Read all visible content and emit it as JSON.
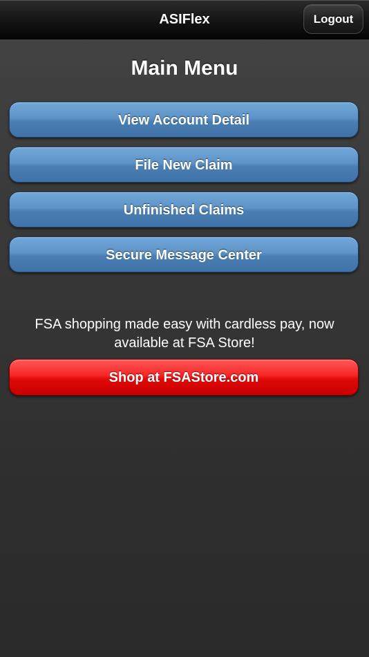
{
  "navbar": {
    "title": "ASIFlex",
    "logout_label": "Logout"
  },
  "main": {
    "title": "Main Menu",
    "menu_items": [
      {
        "label": "View Account Detail"
      },
      {
        "label": "File New Claim"
      },
      {
        "label": "Unfinished Claims"
      },
      {
        "label": "Secure Message Center"
      }
    ]
  },
  "promo": {
    "text": "FSA shopping made easy with cardless pay, now available at FSA Store!",
    "shop_label": "Shop at FSAStore.com"
  },
  "colors": {
    "menu_button": "#5d93c6",
    "shop_button": "#f52525",
    "background": "#3a3a3a",
    "navbar": "#141414"
  }
}
